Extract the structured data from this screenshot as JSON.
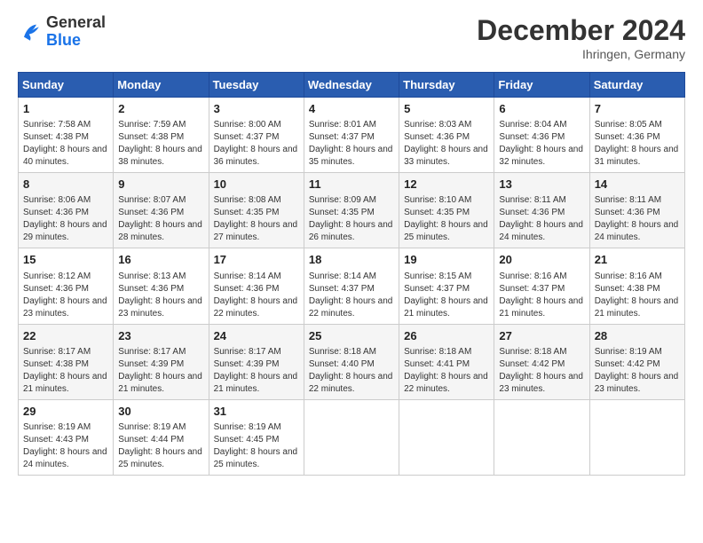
{
  "header": {
    "logo_line1": "General",
    "logo_line2": "Blue",
    "month_title": "December 2024",
    "location": "Ihringen, Germany"
  },
  "days_of_week": [
    "Sunday",
    "Monday",
    "Tuesday",
    "Wednesday",
    "Thursday",
    "Friday",
    "Saturday"
  ],
  "weeks": [
    [
      {
        "day": "1",
        "sunrise": "7:58 AM",
        "sunset": "4:38 PM",
        "daylight": "8 hours and 40 minutes."
      },
      {
        "day": "2",
        "sunrise": "7:59 AM",
        "sunset": "4:38 PM",
        "daylight": "8 hours and 38 minutes."
      },
      {
        "day": "3",
        "sunrise": "8:00 AM",
        "sunset": "4:37 PM",
        "daylight": "8 hours and 36 minutes."
      },
      {
        "day": "4",
        "sunrise": "8:01 AM",
        "sunset": "4:37 PM",
        "daylight": "8 hours and 35 minutes."
      },
      {
        "day": "5",
        "sunrise": "8:03 AM",
        "sunset": "4:36 PM",
        "daylight": "8 hours and 33 minutes."
      },
      {
        "day": "6",
        "sunrise": "8:04 AM",
        "sunset": "4:36 PM",
        "daylight": "8 hours and 32 minutes."
      },
      {
        "day": "7",
        "sunrise": "8:05 AM",
        "sunset": "4:36 PM",
        "daylight": "8 hours and 31 minutes."
      }
    ],
    [
      {
        "day": "8",
        "sunrise": "8:06 AM",
        "sunset": "4:36 PM",
        "daylight": "8 hours and 29 minutes."
      },
      {
        "day": "9",
        "sunrise": "8:07 AM",
        "sunset": "4:36 PM",
        "daylight": "8 hours and 28 minutes."
      },
      {
        "day": "10",
        "sunrise": "8:08 AM",
        "sunset": "4:35 PM",
        "daylight": "8 hours and 27 minutes."
      },
      {
        "day": "11",
        "sunrise": "8:09 AM",
        "sunset": "4:35 PM",
        "daylight": "8 hours and 26 minutes."
      },
      {
        "day": "12",
        "sunrise": "8:10 AM",
        "sunset": "4:35 PM",
        "daylight": "8 hours and 25 minutes."
      },
      {
        "day": "13",
        "sunrise": "8:11 AM",
        "sunset": "4:36 PM",
        "daylight": "8 hours and 24 minutes."
      },
      {
        "day": "14",
        "sunrise": "8:11 AM",
        "sunset": "4:36 PM",
        "daylight": "8 hours and 24 minutes."
      }
    ],
    [
      {
        "day": "15",
        "sunrise": "8:12 AM",
        "sunset": "4:36 PM",
        "daylight": "8 hours and 23 minutes."
      },
      {
        "day": "16",
        "sunrise": "8:13 AM",
        "sunset": "4:36 PM",
        "daylight": "8 hours and 23 minutes."
      },
      {
        "day": "17",
        "sunrise": "8:14 AM",
        "sunset": "4:36 PM",
        "daylight": "8 hours and 22 minutes."
      },
      {
        "day": "18",
        "sunrise": "8:14 AM",
        "sunset": "4:37 PM",
        "daylight": "8 hours and 22 minutes."
      },
      {
        "day": "19",
        "sunrise": "8:15 AM",
        "sunset": "4:37 PM",
        "daylight": "8 hours and 21 minutes."
      },
      {
        "day": "20",
        "sunrise": "8:16 AM",
        "sunset": "4:37 PM",
        "daylight": "8 hours and 21 minutes."
      },
      {
        "day": "21",
        "sunrise": "8:16 AM",
        "sunset": "4:38 PM",
        "daylight": "8 hours and 21 minutes."
      }
    ],
    [
      {
        "day": "22",
        "sunrise": "8:17 AM",
        "sunset": "4:38 PM",
        "daylight": "8 hours and 21 minutes."
      },
      {
        "day": "23",
        "sunrise": "8:17 AM",
        "sunset": "4:39 PM",
        "daylight": "8 hours and 21 minutes."
      },
      {
        "day": "24",
        "sunrise": "8:17 AM",
        "sunset": "4:39 PM",
        "daylight": "8 hours and 21 minutes."
      },
      {
        "day": "25",
        "sunrise": "8:18 AM",
        "sunset": "4:40 PM",
        "daylight": "8 hours and 22 minutes."
      },
      {
        "day": "26",
        "sunrise": "8:18 AM",
        "sunset": "4:41 PM",
        "daylight": "8 hours and 22 minutes."
      },
      {
        "day": "27",
        "sunrise": "8:18 AM",
        "sunset": "4:42 PM",
        "daylight": "8 hours and 23 minutes."
      },
      {
        "day": "28",
        "sunrise": "8:19 AM",
        "sunset": "4:42 PM",
        "daylight": "8 hours and 23 minutes."
      }
    ],
    [
      {
        "day": "29",
        "sunrise": "8:19 AM",
        "sunset": "4:43 PM",
        "daylight": "8 hours and 24 minutes."
      },
      {
        "day": "30",
        "sunrise": "8:19 AM",
        "sunset": "4:44 PM",
        "daylight": "8 hours and 25 minutes."
      },
      {
        "day": "31",
        "sunrise": "8:19 AM",
        "sunset": "4:45 PM",
        "daylight": "8 hours and 25 minutes."
      },
      null,
      null,
      null,
      null
    ]
  ]
}
